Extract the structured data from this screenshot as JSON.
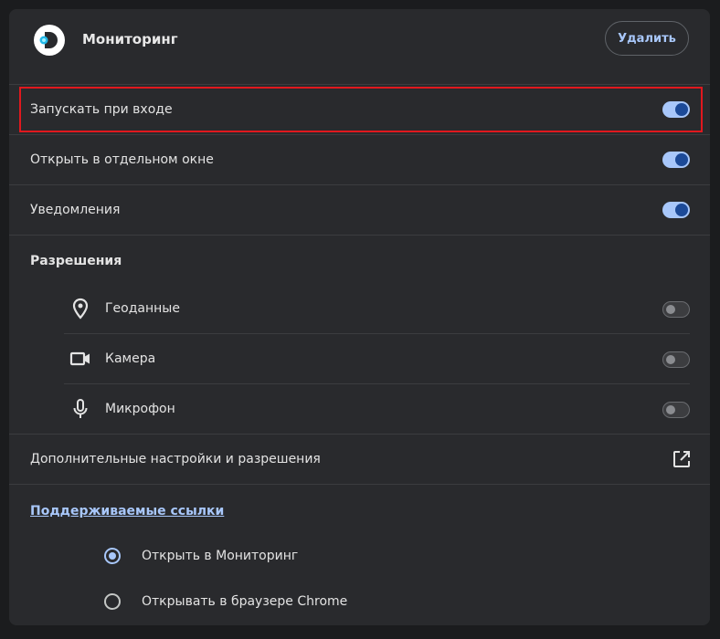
{
  "header": {
    "app_name": "Мониторинг",
    "remove_label": "Удалить"
  },
  "settings": {
    "launch_on_login": {
      "label": "Запускать при входе",
      "enabled": true
    },
    "open_in_window": {
      "label": "Открыть в отдельном окне",
      "enabled": true
    },
    "notifications": {
      "label": "Уведомления",
      "enabled": true
    }
  },
  "permissions": {
    "title": "Разрешения",
    "items": [
      {
        "label": "Геоданные",
        "icon": "location-pin-icon",
        "enabled": false
      },
      {
        "label": "Камера",
        "icon": "video-camera-icon",
        "enabled": false
      },
      {
        "label": "Микрофон",
        "icon": "microphone-icon",
        "enabled": false
      }
    ]
  },
  "more_settings": {
    "label": "Дополнительные настройки и разрешения",
    "icon": "open-in-new-icon"
  },
  "supported_links": {
    "title": "Поддерживаемые ссылки",
    "options": [
      {
        "label": "Открыть в Мониторинг",
        "selected": true
      },
      {
        "label": "Открывать в браузере Chrome",
        "selected": false
      }
    ]
  },
  "colors": {
    "accent": "#a8c7fa",
    "toggle_knob_on": "#1c4a98",
    "highlight": "#e0181e",
    "card_bg": "#292a2d",
    "page_bg": "#1b1c1e"
  }
}
